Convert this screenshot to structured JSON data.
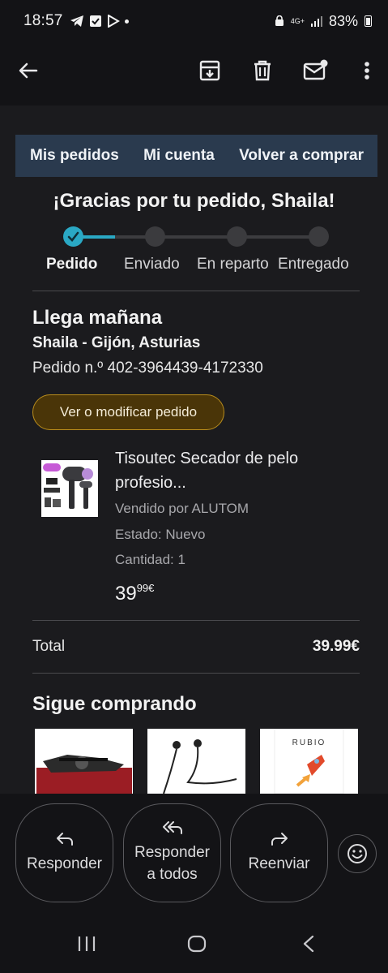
{
  "status_bar": {
    "time": "18:57",
    "battery": "83%",
    "network": "4G+"
  },
  "app_bar": {
    "icons": [
      "back-arrow-icon",
      "archive-icon",
      "delete-icon",
      "mark-unread-icon",
      "more-vert-icon"
    ]
  },
  "email": {
    "nav": [
      "Mis pedidos",
      "Mi cuenta",
      "Volver a comprar"
    ],
    "heading": "¡Gracias por tu pedido, Shaila!",
    "steps": [
      "Pedido",
      "Enviado",
      "En reparto",
      "Entregado"
    ],
    "active_step": 0,
    "arrival": "Llega mañana",
    "address": "Shaila - Gijón, Asturias",
    "order_number": "Pedido n.º 402-3964439-4172330",
    "view_button": "Ver o modificar pedido",
    "product": {
      "title": "Tisoutec Secador de pelo profesio...",
      "seller": "Vendido por ALUTOM",
      "condition": "Estado: Nuevo",
      "quantity": "Cantidad: 1",
      "price_whole": "39",
      "price_fraction": "99€"
    },
    "total_label": "Total",
    "total_value": "39.99€",
    "keep_shopping": "Sigue comprando",
    "reco_book_text": "RUBIO"
  },
  "actions": {
    "reply": "Responder",
    "reply_all_line1": "Responder",
    "reply_all_line2": "a todos",
    "forward": "Reenviar"
  },
  "colors": {
    "accent_tracker": "#2aa8c4",
    "nav_bg": "#2a3a4e",
    "button_gold": "#b98d1c"
  }
}
